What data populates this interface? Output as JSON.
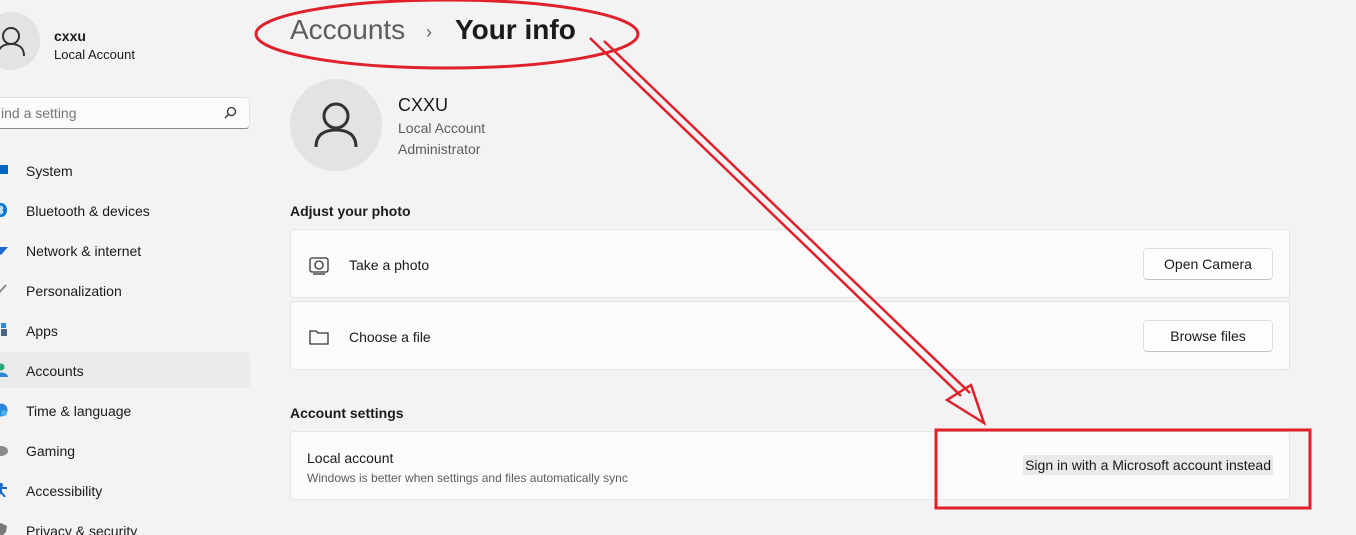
{
  "user": {
    "name": "cxxu",
    "account_type": "Local Account"
  },
  "search": {
    "placeholder": "ind a setting"
  },
  "sidebar": {
    "items": [
      {
        "label": "System",
        "icon": "monitor-icon",
        "color": "#0067c0"
      },
      {
        "label": "Bluetooth & devices",
        "icon": "bluetooth-icon",
        "color": "#0078d4"
      },
      {
        "label": "Network & internet",
        "icon": "wifi-icon",
        "color": "#1b6ac9"
      },
      {
        "label": "Personalization",
        "icon": "brush-icon",
        "color": "#c75b2a"
      },
      {
        "label": "Apps",
        "icon": "apps-icon",
        "color": "#4b6584"
      },
      {
        "label": "Accounts",
        "icon": "person-icon",
        "color": "#2ea77a",
        "active": true
      },
      {
        "label": "Time & language",
        "icon": "globe-icon",
        "color": "#2b88d8"
      },
      {
        "label": "Gaming",
        "icon": "gamepad-icon",
        "color": "#6b6b6b"
      },
      {
        "label": "Accessibility",
        "icon": "accessibility-icon",
        "color": "#1b6ac9"
      },
      {
        "label": "Privacy & security",
        "icon": "shield-icon",
        "color": "#6b6b6b"
      }
    ]
  },
  "breadcrumb": {
    "parent": "Accounts",
    "separator": "›",
    "current": "Your info"
  },
  "profile": {
    "name": "CXXU",
    "account_type": "Local Account",
    "role": "Administrator"
  },
  "photo_section": {
    "title": "Adjust your photo",
    "take_photo": {
      "label": "Take a photo",
      "button": "Open Camera",
      "icon": "camera-icon"
    },
    "choose_file": {
      "label": "Choose a file",
      "button": "Browse files",
      "icon": "folder-icon"
    }
  },
  "account_settings": {
    "title": "Account settings",
    "local_account": {
      "title": "Local account",
      "subtitle": "Windows is better when settings and files automatically sync",
      "link": "Sign in with a Microsoft account instead"
    }
  },
  "colors": {
    "background": "#f3f3f3",
    "card": "#fbfbfb",
    "annotation": "#e0202a"
  }
}
